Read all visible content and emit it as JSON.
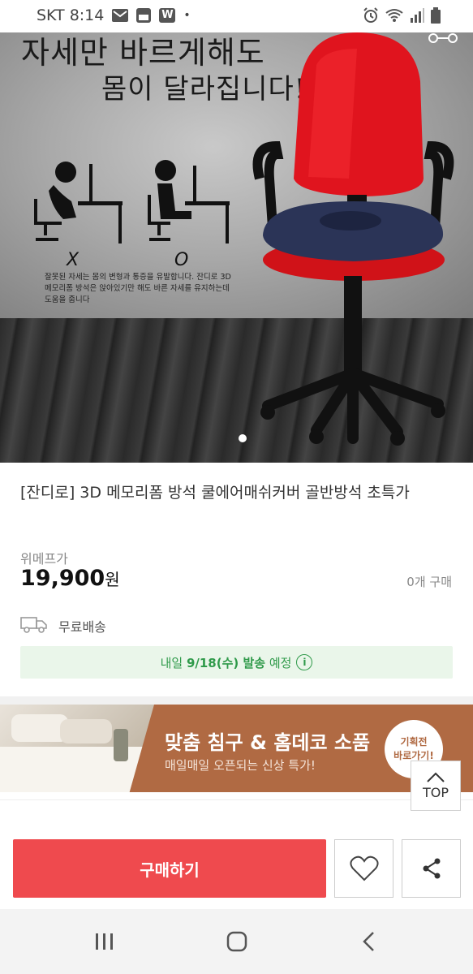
{
  "status_bar": {
    "carrier_time": "SKT 8:14",
    "icons": [
      "mail-icon",
      "app-icon",
      "w-app-icon",
      "alarm-icon",
      "wifi-icon",
      "signal-icon",
      "battery-icon"
    ],
    "w_label": "W"
  },
  "hero": {
    "headline_line1": "자세만 바르게해도",
    "headline_line2": "몸이 달라집니다!!",
    "wrong_mark": "X",
    "right_mark": "O",
    "caption": "잘못된 자세는 몸의 변형과 통증을 유발합니다. 잔디로 3D 메모리폼 방석은 앉아있기만 해도 바른 자세를 유지하는데 도움을 줍니다",
    "carousel_index": 1
  },
  "product": {
    "title": "[잔디로] 3D 메모리폼 방석 쿨에어매쉬커버 골반방석 초특가",
    "price_label": "위메프가",
    "price": "19,900",
    "price_unit": "원",
    "sold_count": "0개 구매",
    "shipping": "무료배송",
    "delivery_prefix": "내일 ",
    "delivery_date": "9/18(수) 발송",
    "delivery_suffix": " 예정"
  },
  "banner": {
    "title": "맞춤 침구 & 홈데코 소품",
    "subtitle": "매일매일 오픈되는 신상 특가!",
    "badge_line1": "기획전",
    "badge_line2": "바로가기!"
  },
  "top_button": {
    "label": "TOP"
  },
  "actions": {
    "buy_label": "구매하기"
  },
  "colors": {
    "buy": "#ef4a4e",
    "delivery_bg": "#eaf6ea",
    "delivery_text": "#2f9a4a",
    "banner": "#b06a43"
  }
}
